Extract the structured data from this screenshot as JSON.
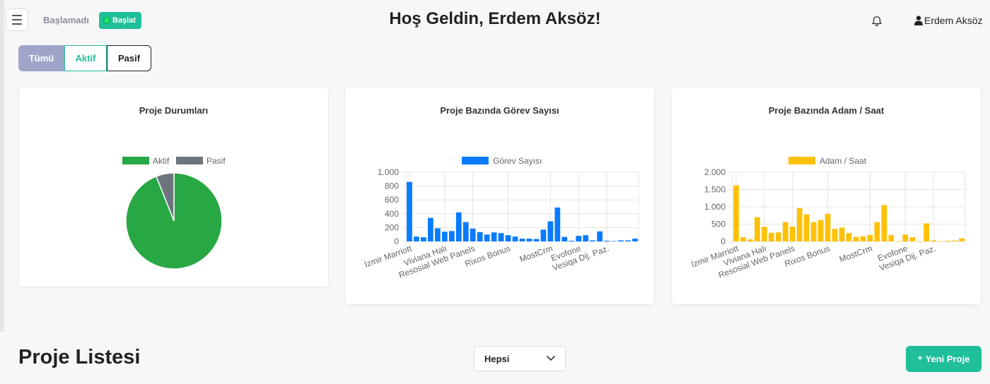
{
  "header": {
    "status": "Başlamadı",
    "start_label": "Başlat",
    "title": "Hoş Geldin, Erdem Aksöz!",
    "user_name": "Erdem Aksöz"
  },
  "filters": {
    "all": "Tümü",
    "active": "Aktif",
    "passive": "Pasif",
    "selected": "all"
  },
  "colors": {
    "green": "#28a745",
    "gray": "#6c757d",
    "blue": "#0a7bff",
    "yellow": "#ffc107",
    "teal": "#1fbf9a"
  },
  "chart_data": [
    {
      "type": "pie",
      "title": "Proje Durumları",
      "labels": [
        "Aktif",
        "Pasif"
      ],
      "values": [
        94,
        6
      ],
      "colors": [
        "#28a745",
        "#6c757d"
      ],
      "legend": "top"
    },
    {
      "type": "bar",
      "title": "Proje Bazında Görev Sayısı",
      "series": [
        {
          "name": "Görev Sayısı",
          "color": "#0a7bff",
          "values": [
            860,
            70,
            60,
            340,
            190,
            140,
            150,
            420,
            280,
            185,
            135,
            100,
            130,
            120,
            90,
            70,
            40,
            40,
            35,
            170,
            290,
            490,
            65,
            10,
            80,
            90,
            15,
            145,
            10,
            5,
            15,
            15,
            40
          ]
        }
      ],
      "tick_labels": [
        {
          "index": 0,
          "text": "İzmir Marriott"
        },
        {
          "index": 5,
          "text": "Viviana Halı"
        },
        {
          "index": 9,
          "text": "Resosial Web Panels"
        },
        {
          "index": 14,
          "text": "Rixos Bonus"
        },
        {
          "index": 20,
          "text": "MostCrm"
        },
        {
          "index": 24,
          "text": "Evofone"
        },
        {
          "index": 28,
          "text": "Vesiqa Dij. Paz."
        }
      ],
      "yticks": [
        "0",
        "200",
        "400",
        "600",
        "800",
        "1.000"
      ],
      "ylim": [
        0,
        1000
      ],
      "grid": true,
      "legend": "top"
    },
    {
      "type": "bar",
      "title": "Proje Bazında Adam / Saat",
      "series": [
        {
          "name": "Adam / Saat",
          "color": "#ffc107",
          "values": [
            1620,
            120,
            60,
            700,
            420,
            250,
            260,
            560,
            430,
            960,
            780,
            560,
            620,
            800,
            360,
            400,
            240,
            130,
            150,
            190,
            560,
            1050,
            180,
            5,
            200,
            120,
            5,
            520,
            30,
            5,
            20,
            25,
            90
          ]
        }
      ],
      "tick_labels": [
        {
          "index": 0,
          "text": "İzmir Marriott"
        },
        {
          "index": 4,
          "text": "Viviana Halı"
        },
        {
          "index": 8,
          "text": "Resosial Web Panels"
        },
        {
          "index": 13,
          "text": "Rixos Bonus"
        },
        {
          "index": 19,
          "text": "MostCrm"
        },
        {
          "index": 24,
          "text": "Evofone"
        },
        {
          "index": 28,
          "text": "Vesiqa Dij. Paz."
        }
      ],
      "yticks": [
        "0",
        "500",
        "1.000",
        "1.500",
        "2.000"
      ],
      "ylim": [
        0,
        2000
      ],
      "grid": true,
      "legend": "top"
    }
  ],
  "projects": {
    "title": "Proje Listesi",
    "select_value": "Hepsi",
    "new_label": "Yeni Proje"
  }
}
